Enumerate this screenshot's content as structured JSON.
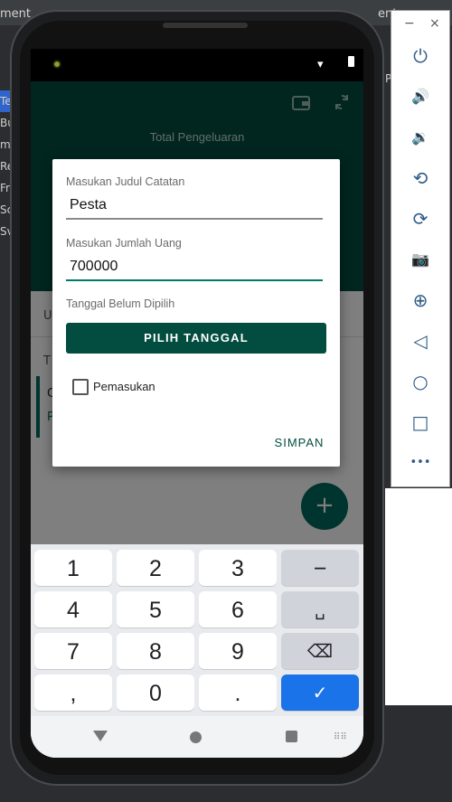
{
  "ide": {
    "tab_left": "ment_",
    "tab_right": "ent_n",
    "tree_items": [
      "Te",
      "Bu",
      "m",
      "Re",
      "Fr",
      "Sc",
      "Sv"
    ],
    "right_fragment": "P"
  },
  "appbar": {
    "total_label": "Total Pengeluaran",
    "wallet_icon": "wallet-icon",
    "sync_icon": "sync-icon"
  },
  "background_list": {
    "header_fragment": "U",
    "row_fragment": "T",
    "item_fragment_1": "C",
    "item_fragment_2": "P"
  },
  "dialog": {
    "title_label": "Masukan Judul Catatan",
    "title_value": "Pesta",
    "amount_label": "Masukan Jumlah Uang",
    "amount_value": "700000",
    "date_status": "Tanggal Belum Dipilih",
    "pick_date_button": "PILIH TANGGAL",
    "income_checkbox_label": "Pemasukan",
    "income_checked": false,
    "save_button": "SIMPAN"
  },
  "fab": {
    "symbol": "+"
  },
  "keyboard": {
    "rows": [
      [
        "1",
        "2",
        "3",
        "−"
      ],
      [
        "4",
        "5",
        "6",
        "␣"
      ],
      [
        "7",
        "8",
        "9",
        "⌫"
      ],
      [
        ",",
        "0",
        ".",
        "✓"
      ]
    ]
  },
  "emulator": {
    "minimize": "−",
    "close": "×",
    "buttons": [
      "power-icon",
      "volume-up-icon",
      "volume-down-icon",
      "rotate-left-icon",
      "rotate-right-icon",
      "camera-icon",
      "zoom-icon",
      "back-icon",
      "home-icon",
      "overview-icon",
      "more-icon"
    ],
    "glyphs": [
      "⏻",
      "🔊",
      "🔉",
      "⟲",
      "⟳",
      "📷",
      "⊕",
      "◁",
      "○",
      "□",
      "•••"
    ]
  },
  "colors": {
    "primary": "#024d3f",
    "accent": "#00796b",
    "keyboard_done": "#1a73e8"
  }
}
